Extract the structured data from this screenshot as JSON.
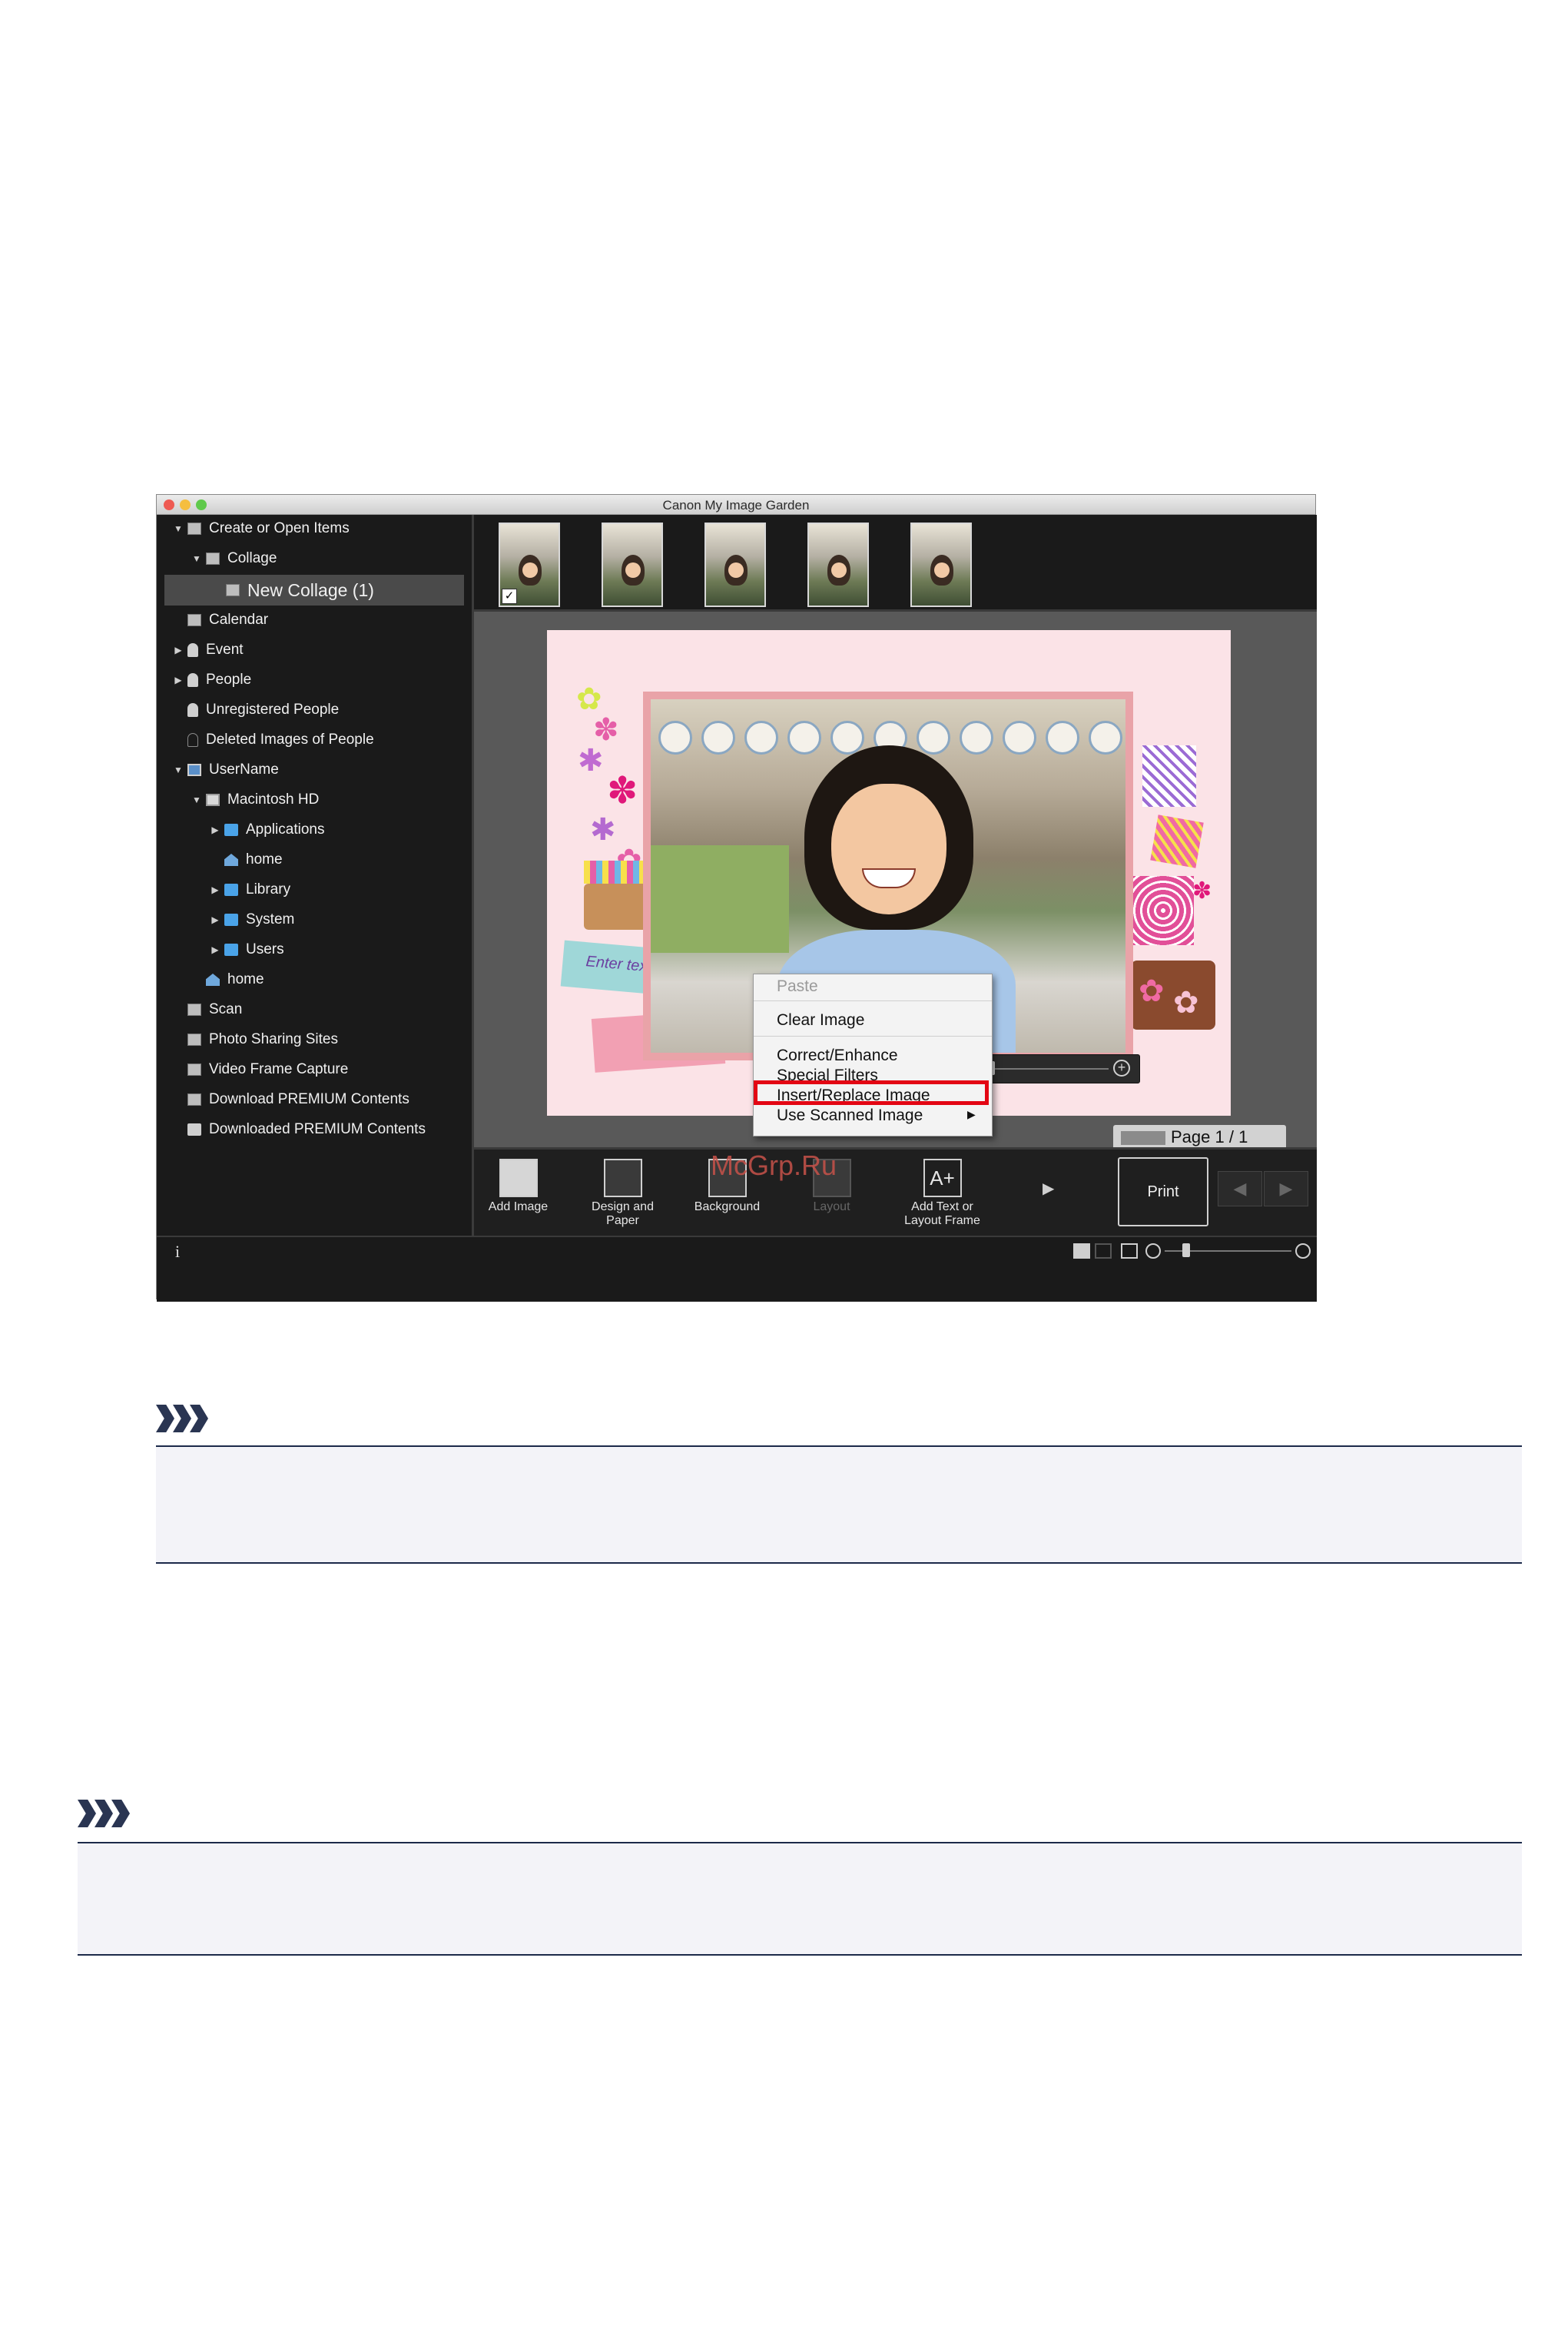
{
  "window": {
    "title": "Canon My Image Garden"
  },
  "sidebar": {
    "items": [
      {
        "label": "Create or Open Items"
      },
      {
        "label": "Collage"
      },
      {
        "label": "New Collage (1)"
      },
      {
        "label": "Calendar"
      },
      {
        "label": "Event"
      },
      {
        "label": "People"
      },
      {
        "label": "Unregistered People"
      },
      {
        "label": "Deleted Images of People"
      },
      {
        "label": "UserName"
      },
      {
        "label": "Macintosh HD"
      },
      {
        "label": "Applications"
      },
      {
        "label": "home"
      },
      {
        "label": "Library"
      },
      {
        "label": "System"
      },
      {
        "label": "Users"
      },
      {
        "label": "home"
      },
      {
        "label": "Scan"
      },
      {
        "label": "Photo Sharing Sites"
      },
      {
        "label": "Video Frame Capture"
      },
      {
        "label": "Download PREMIUM Contents"
      },
      {
        "label": "Downloaded PREMIUM Contents"
      }
    ]
  },
  "canvas": {
    "enter_text": "Enter text",
    "page_label": "Page 1 / 1"
  },
  "context_menu": {
    "items": [
      {
        "label": "Paste"
      },
      {
        "label": "Clear Image"
      },
      {
        "label": "Correct/Enhance"
      },
      {
        "label": "Special Filters"
      },
      {
        "label": "Insert/Replace Image"
      },
      {
        "label": "Use Scanned Image"
      }
    ],
    "submenu_arrow": "▶"
  },
  "toolbar": {
    "add_image": "Add Image",
    "design_paper": "Design and\nPaper",
    "background": "Background",
    "layout": "Layout",
    "add_text": "Add Text or\nLayout Frame",
    "print": "Print",
    "prev": "◀",
    "next": "▶",
    "more": "▶"
  },
  "statusbar": {
    "info": "i"
  },
  "watermark": "McGrp.Ru",
  "colors": {
    "highlight": "#e30613",
    "sidebar_bg": "#1a1a1a",
    "editor_bg": "#595959",
    "page_bg": "#fbe3e7",
    "note_rule": "#1c2a4a"
  }
}
